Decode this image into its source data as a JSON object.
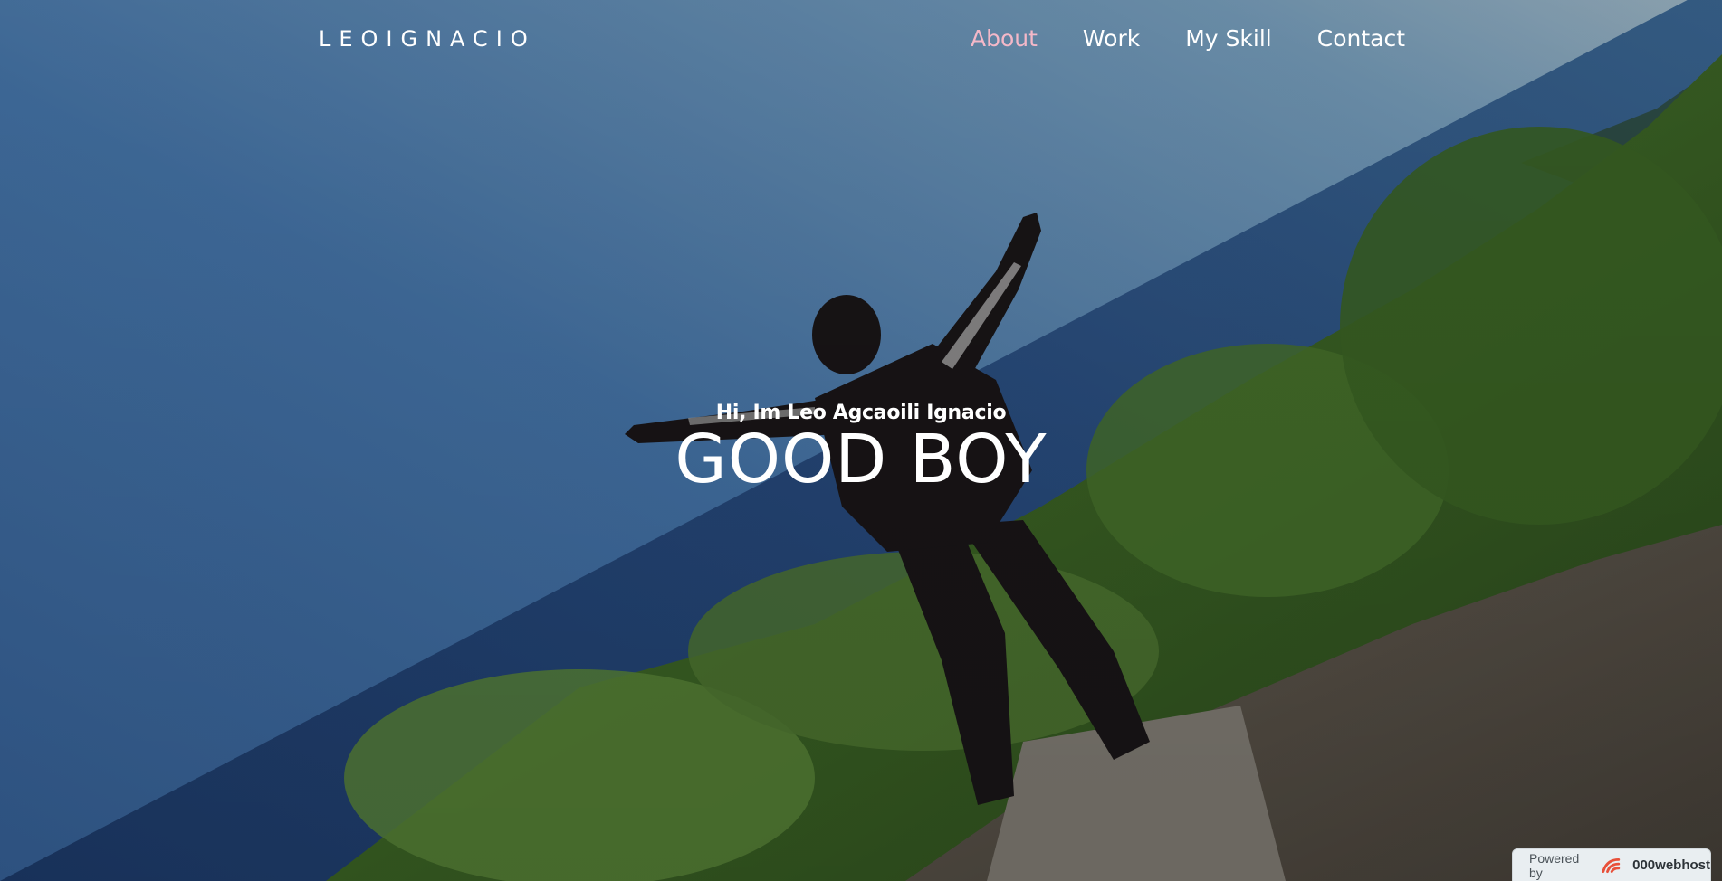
{
  "site": {
    "logo": "LEOIGNACIO"
  },
  "nav": {
    "items": [
      {
        "label": "About",
        "active": true
      },
      {
        "label": "Work",
        "active": false
      },
      {
        "label": "My Skill",
        "active": false
      },
      {
        "label": "Contact",
        "active": false
      }
    ]
  },
  "hero": {
    "greeting": "Hi, Im Leo Agcaoili Ignacio",
    "headline": "GOOD BOY",
    "background_image": "person-with-arms-outstretched-on-cliff-overlooking-ocean"
  },
  "badge": {
    "prefix": "Powered by",
    "brand": "000webhost",
    "icon": "000webhost-logo-icon"
  },
  "colors": {
    "active_nav": "#f4b8c8",
    "text": "#ffffff",
    "sky": "#3f6ea8",
    "sea": "#23487e",
    "vegetation": "#4f7a32"
  }
}
